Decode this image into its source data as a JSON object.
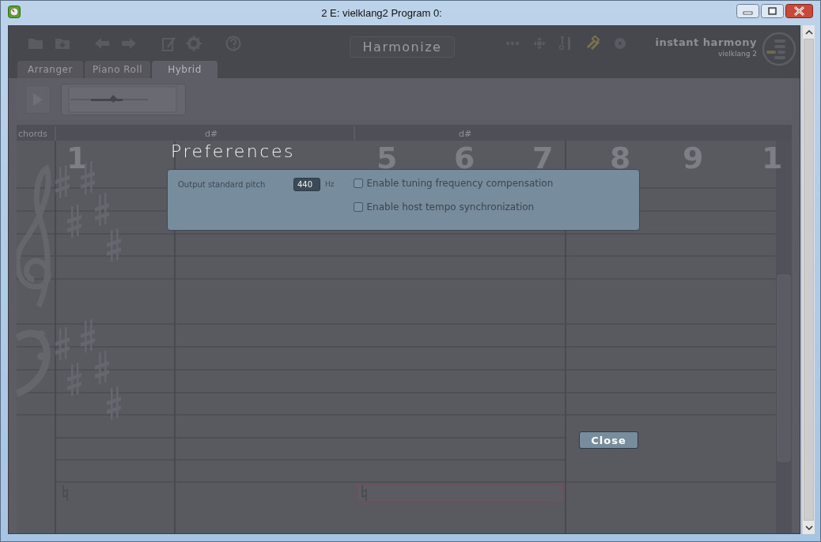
{
  "window": {
    "title": "2 E: vielklang2 Program 0:"
  },
  "toolbar": {
    "harmonize_button": "Harmonize",
    "brand": {
      "name": "instant harmony",
      "version": "vielklang 2"
    }
  },
  "tabs": [
    {
      "label": "Arranger",
      "selected": false
    },
    {
      "label": "Piano Roll",
      "selected": false
    },
    {
      "label": "Hybrid",
      "selected": true
    }
  ],
  "score": {
    "chord_column": "chords",
    "chords": [
      "d#",
      "d#"
    ],
    "measures": [
      "1",
      "5",
      "6",
      "7",
      "8",
      "9",
      "1"
    ]
  },
  "dialog": {
    "title": "Preferences",
    "pitch": {
      "label": "Output standard pitch",
      "value": "440",
      "unit": "Hz"
    },
    "options": [
      {
        "label": "Enable tuning frequency compensation",
        "checked": false
      },
      {
        "label": "Enable host tempo synchronization",
        "checked": false
      }
    ],
    "close_button": "Close"
  }
}
